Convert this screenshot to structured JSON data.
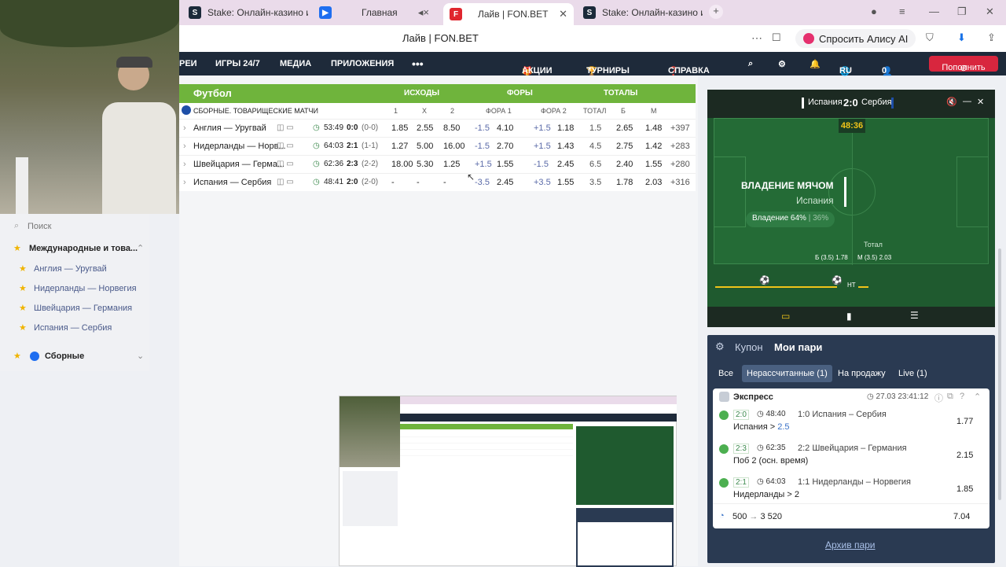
{
  "tabs": [
    {
      "label": "Stake: Онлайн-казино и с",
      "icon": "S"
    },
    {
      "label": "Главная",
      "icon": "▶"
    },
    {
      "label": "Лайв | FON.BET",
      "icon": "F"
    },
    {
      "label": "Stake: Онлайн-казино и с",
      "icon": "S"
    }
  ],
  "address": {
    "title": "Лайв | FON.BET",
    "alice": "Спросить Алису AI"
  },
  "nav": {
    "items": [
      "РЕИ",
      "ИГРЫ 24/7",
      "МЕДИА",
      "ПРИЛОЖЕНИЯ",
      "•••",
      "АКЦИИ",
      "ТУРНИРЫ",
      "СПРАВКА",
      "RU",
      "0"
    ],
    "topup": "Пополнить"
  },
  "sport": {
    "title": "Футбол",
    "cols": [
      "ИСХОДЫ",
      "ФОРЫ",
      "ТОТАЛЫ"
    ]
  },
  "league": {
    "title": "СБОРНЫЕ. ТОВАРИЩЕСКИЕ МАТЧИ",
    "heads": [
      "1",
      "X",
      "2",
      "ФОРА 1",
      "ФОРА 2",
      "ТОТАЛ",
      "Б",
      "М"
    ]
  },
  "matches": [
    {
      "name": "Англия — Уругвай",
      "time": "53:49",
      "score": "0:0",
      "sub": "(0-0)",
      "o1": "1.85",
      "ox": "2.55",
      "o2": "8.50",
      "h1": "-1.5",
      "h1o": "4.10",
      "h2": "+1.5",
      "h2o": "1.18",
      "t": "1.5",
      "tb": "2.65",
      "tm": "1.48",
      "more": "+397"
    },
    {
      "name": "Нидерланды — Норв...",
      "time": "64:03",
      "score": "2:1",
      "sub": "(1-1)",
      "o1": "1.27",
      "ox": "5.00",
      "o2": "16.00",
      "h1": "-1.5",
      "h1o": "2.70",
      "h2": "+1.5",
      "h2o": "1.43",
      "t": "4.5",
      "tb": "2.75",
      "tm": "1.42",
      "more": "+283"
    },
    {
      "name": "Швейцария — Герма...",
      "time": "62:36",
      "score": "2:3",
      "sub": "(2-2)",
      "o1": "18.00",
      "ox": "5.30",
      "o2": "1.25",
      "h1": "+1.5",
      "h1o": "1.55",
      "h2": "-1.5",
      "h2o": "2.45",
      "t": "6.5",
      "tb": "2.40",
      "tm": "1.55",
      "more": "+280"
    },
    {
      "name": "Испания — Сербия",
      "time": "48:41",
      "score": "2:0",
      "sub": "(2-0)",
      "o1": "-",
      "ox": "-",
      "o2": "-",
      "h1": "-3.5",
      "h1o": "2.45",
      "h2": "+3.5",
      "h2o": "1.55",
      "t": "3.5",
      "tb": "1.78",
      "tm": "2.03",
      "more": "+316"
    }
  ],
  "sidebar": {
    "search": "Поиск",
    "group": "Международные и това...",
    "items": [
      "Англия — Уругвай",
      "Нидерланды — Норвегия",
      "Швейцария — Германия",
      "Испания — Сербия"
    ],
    "group2": "Сборные"
  },
  "widget": {
    "team1": "Испания",
    "score": "2:0",
    "team2": "Сербия",
    "clock": "48:36",
    "stat": "ВЛАДЕНИЕ МЯЧОМ",
    "statTeam": "Испания",
    "poss": "Владение 64%",
    "poss2": "36%",
    "total": "Тотал",
    "tb": "Б (3.5)",
    "tbv": "1.78",
    "tm": "М (3.5)",
    "tmv": "2.03",
    "ht": "HT"
  },
  "coupon": {
    "title": "Купон",
    "mybets": "Мои пари",
    "tabs": [
      "Все",
      "Нерассчитанные (1)",
      "На продажу",
      "Live (1)"
    ],
    "type": "Экспресс",
    "date": "27.03",
    "time": "23:41:12",
    "legs": [
      {
        "score": "2:0",
        "time": "48:40",
        "match": "1:0 Испания – Сербия",
        "bet": "Испания > ",
        "val": "2.5",
        "odd": "1.77"
      },
      {
        "score": "2:3",
        "time": "62:35",
        "match": "2:2 Швейцария – Германия",
        "bet": "Поб 2 (осн. время)",
        "val": "",
        "odd": "2.15"
      },
      {
        "score": "2:1",
        "time": "64:03",
        "match": "1:1 Нидерланды – Норвегия",
        "bet": "Нидерланды > 2",
        "val": "",
        "odd": "1.85"
      }
    ],
    "stake": "500",
    "arrow": "→",
    "payout": "3 520",
    "total": "7.04",
    "archive": "Архив пари"
  },
  "colors": {
    "green": "#6fb43c",
    "navy": "#1e2a3a",
    "red": "#d8263e"
  }
}
